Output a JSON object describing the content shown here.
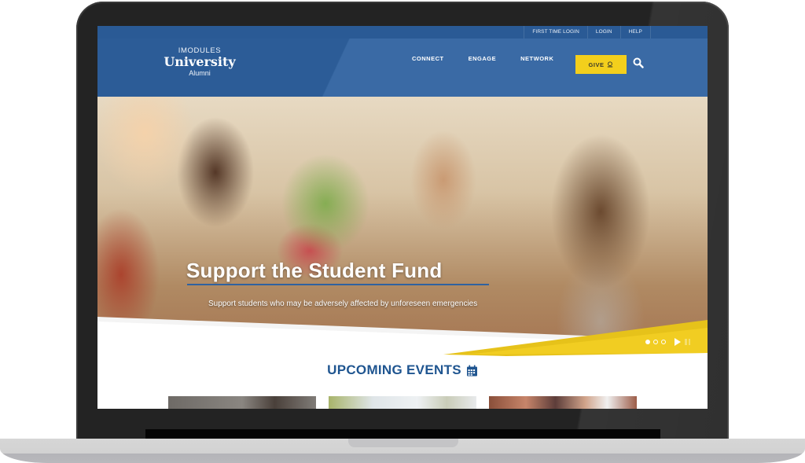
{
  "utility_nav": [
    "First Time Login",
    "Login",
    "Help"
  ],
  "logo": {
    "top": "IMODULES",
    "mid": "University",
    "bot": "Alumni"
  },
  "main_nav": [
    "Connect",
    "Engage",
    "Network"
  ],
  "give_button": {
    "label": "GIVE",
    "icon": "donation-icon"
  },
  "search": {
    "icon": "search-icon"
  },
  "hero": {
    "title": "Support the Student Fund",
    "subtitle": "Support students who may be adversely affected by unforeseen emergencies",
    "slides_total": 3,
    "slide_active": 1
  },
  "events": {
    "heading": "UPCOMING EVENTS",
    "icon": "calendar-icon",
    "cards": 3
  },
  "colors": {
    "brand_blue": "#2f62a0",
    "accent_yellow": "#f3cf1c",
    "heading_blue": "#1f5590"
  }
}
